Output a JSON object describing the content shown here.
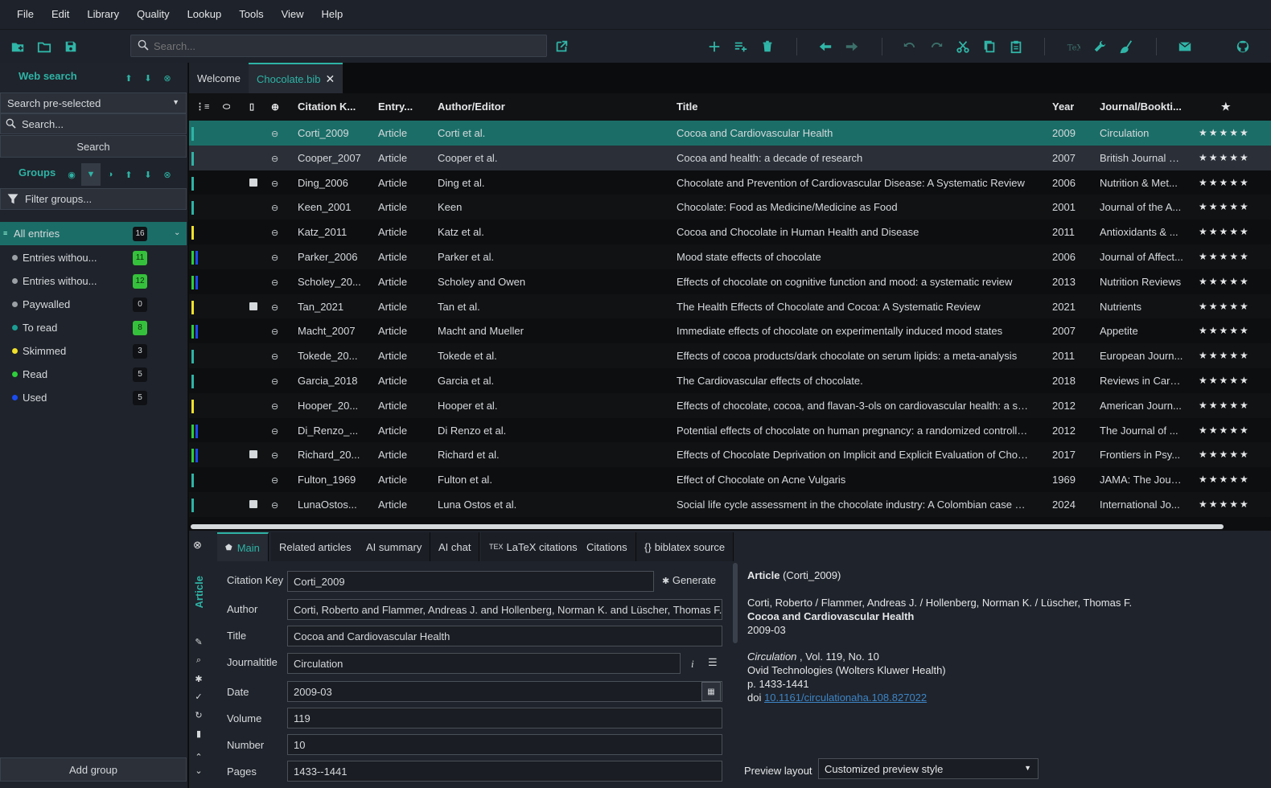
{
  "menu": [
    "File",
    "Edit",
    "Library",
    "Quality",
    "Lookup",
    "Tools",
    "View",
    "Help"
  ],
  "toolbar": {
    "search_placeholder": "Search..."
  },
  "sidebar": {
    "web_search_title": "Web search",
    "search_select": "Search pre-selected",
    "search_placeholder": "Search...",
    "search_button": "Search",
    "groups_title": "Groups",
    "filter_placeholder": "Filter groups...",
    "add_group": "Add group",
    "groups": [
      {
        "label": "All entries",
        "count": "16",
        "color": "#2eb3a5",
        "green": false
      },
      {
        "label": "Entries withou...",
        "count": "11",
        "color": "#9aa0a6",
        "green": true
      },
      {
        "label": "Entries withou...",
        "count": "12",
        "color": "#9aa0a6",
        "green": true
      },
      {
        "label": "Paywalled",
        "count": "0",
        "color": "#9aa0a6",
        "green": false
      },
      {
        "label": "To read",
        "count": "8",
        "color": "#1b9e94",
        "green": true
      },
      {
        "label": "Skimmed",
        "count": "3",
        "color": "#f0e02a",
        "green": false
      },
      {
        "label": "Read",
        "count": "5",
        "color": "#2fcf3b",
        "green": false
      },
      {
        "label": "Used",
        "count": "5",
        "color": "#1a4cf0",
        "green": false
      }
    ]
  },
  "tabs": {
    "welcome": "Welcome",
    "library": "Chocolate.bib"
  },
  "table": {
    "headers": {
      "key": "Citation K...",
      "type": "Entry...",
      "author": "Author/Editor",
      "title": "Title",
      "year": "Year",
      "journal": "Journal/Bookti...",
      "rank": "★"
    },
    "stars": "★★★★★",
    "rows": [
      {
        "key": "Corti_2009",
        "type": "Article",
        "author": "Corti et al.",
        "title": "Cocoa and Cardiovascular Health",
        "year": "2009",
        "journal": "Circulation",
        "file": false,
        "bars": [
          "#2eb3a5"
        ]
      },
      {
        "key": "Cooper_2007",
        "type": "Article",
        "author": "Cooper et al.",
        "title": "Cocoa and health: a decade of research",
        "year": "2007",
        "journal": "British Journal o...",
        "file": false,
        "bars": [
          "#2eb3a5"
        ]
      },
      {
        "key": "Ding_2006",
        "type": "Article",
        "author": "Ding et al.",
        "title": "Chocolate and Prevention of Cardiovascular Disease: A Systematic Review",
        "year": "2006",
        "journal": "Nutrition & Met...",
        "file": true,
        "bars": [
          "#2eb3a5"
        ]
      },
      {
        "key": "Keen_2001",
        "type": "Article",
        "author": "Keen",
        "title": "Chocolate: Food as Medicine/Medicine as Food",
        "year": "2001",
        "journal": "Journal of the A...",
        "file": false,
        "bars": [
          "#2eb3a5"
        ]
      },
      {
        "key": "Katz_2011",
        "type": "Article",
        "author": "Katz et al.",
        "title": "Cocoa and Chocolate in Human Health and Disease",
        "year": "2011",
        "journal": "Antioxidants & ...",
        "file": false,
        "bars": [
          "#f0e02a"
        ]
      },
      {
        "key": "Parker_2006",
        "type": "Article",
        "author": "Parker et al.",
        "title": "Mood state effects of chocolate",
        "year": "2006",
        "journal": "Journal of Affect...",
        "file": false,
        "bars": [
          "#2fcf3b",
          "#1a4cf0"
        ]
      },
      {
        "key": "Scholey_20...",
        "type": "Article",
        "author": "Scholey and Owen",
        "title": "Effects of chocolate on cognitive function and mood: a systematic review",
        "year": "2013",
        "journal": "Nutrition Reviews",
        "file": false,
        "bars": [
          "#2fcf3b",
          "#1a4cf0"
        ]
      },
      {
        "key": "Tan_2021",
        "type": "Article",
        "author": "Tan et al.",
        "title": "The Health Effects of Chocolate and Cocoa: A Systematic Review",
        "year": "2021",
        "journal": "Nutrients",
        "file": true,
        "bars": [
          "#f0e02a"
        ]
      },
      {
        "key": "Macht_2007",
        "type": "Article",
        "author": "Macht and Mueller",
        "title": "Immediate effects of chocolate on experimentally induced mood states",
        "year": "2007",
        "journal": "Appetite",
        "file": false,
        "bars": [
          "#2fcf3b",
          "#1a4cf0"
        ]
      },
      {
        "key": "Tokede_20...",
        "type": "Article",
        "author": "Tokede et al.",
        "title": "Effects of cocoa products/dark chocolate on serum lipids: a meta-analysis",
        "year": "2011",
        "journal": "European Journ...",
        "file": false,
        "bars": [
          "#2eb3a5"
        ]
      },
      {
        "key": "Garcia_2018",
        "type": "Article",
        "author": "Garcia et al.",
        "title": "The Cardiovascular effects of chocolate.",
        "year": "2018",
        "journal": "Reviews in Cardi...",
        "file": false,
        "bars": [
          "#2eb3a5"
        ]
      },
      {
        "key": "Hooper_20...",
        "type": "Article",
        "author": "Hooper et al.",
        "title": "Effects of chocolate, cocoa, and flavan-3-ols on cardiovascular health: a syste...",
        "year": "2012",
        "journal": "American Journ...",
        "file": false,
        "bars": [
          "#f0e02a"
        ]
      },
      {
        "key": "Di_Renzo_...",
        "type": "Article",
        "author": "Di Renzo et al.",
        "title": "Potential effects of chocolate on human pregnancy: a randomized controlled...",
        "year": "2012",
        "journal": "The Journal of ...",
        "file": false,
        "bars": [
          "#2fcf3b",
          "#1a4cf0"
        ]
      },
      {
        "key": "Richard_20...",
        "type": "Article",
        "author": "Richard et al.",
        "title": "Effects of Chocolate Deprivation on Implicit and Explicit Evaluation of Chocol...",
        "year": "2017",
        "journal": "Frontiers in Psy...",
        "file": true,
        "bars": [
          "#2fcf3b",
          "#1a4cf0"
        ]
      },
      {
        "key": "Fulton_1969",
        "type": "Article",
        "author": "Fulton et al.",
        "title": "Effect of Chocolate on Acne Vulgaris",
        "year": "1969",
        "journal": "JAMA: The Journ...",
        "file": false,
        "bars": [
          "#2eb3a5"
        ]
      },
      {
        "key": "LunaOstos...",
        "type": "Article",
        "author": "Luna Ostos et al.",
        "title": "Social life cycle assessment in the chocolate industry: A Colombian case stud...",
        "year": "2024",
        "journal": "International Jo...",
        "file": true,
        "bars": [
          "#2eb3a5"
        ]
      }
    ]
  },
  "editor": {
    "tabs": [
      "Main",
      "Related articles",
      "AI summary",
      "AI chat",
      "LaTeX citations",
      "Citations",
      "biblatex source"
    ],
    "entry_type": "Article",
    "generate": "Generate",
    "fields": [
      {
        "label": "Citation Key",
        "value": "Corti_2009"
      },
      {
        "label": "Author",
        "value": "Corti, Roberto and Flammer, Andreas J. and Hollenberg, Norman K. and Lüscher, Thomas F."
      },
      {
        "label": "Title",
        "value": "Cocoa and Cardiovascular Health"
      },
      {
        "label": "Journaltitle",
        "value": "Circulation"
      },
      {
        "label": "Date",
        "value": "2009-03"
      },
      {
        "label": "Volume",
        "value": "119"
      },
      {
        "label": "Number",
        "value": "10"
      },
      {
        "label": "Pages",
        "value": "1433--1441"
      }
    ]
  },
  "preview": {
    "type": "Article",
    "key": "(Corti_2009)",
    "authors": "Corti, Roberto / Flammer, Andreas J. / Hollenberg, Norman K. / Lüscher, Thomas F.",
    "title": "Cocoa and Cardiovascular Health",
    "date": "2009-03",
    "journal": "Circulation",
    "vol": " , Vol. 119, No. 10",
    "publisher": "Ovid Technologies (Wolters Kluwer Health)",
    "pages": "p. 1433-1441",
    "doi_label": "doi",
    "doi": "10.1161/circulationaha.108.827022",
    "layout_label": "Preview layout",
    "layout_value": "Customized preview style"
  }
}
